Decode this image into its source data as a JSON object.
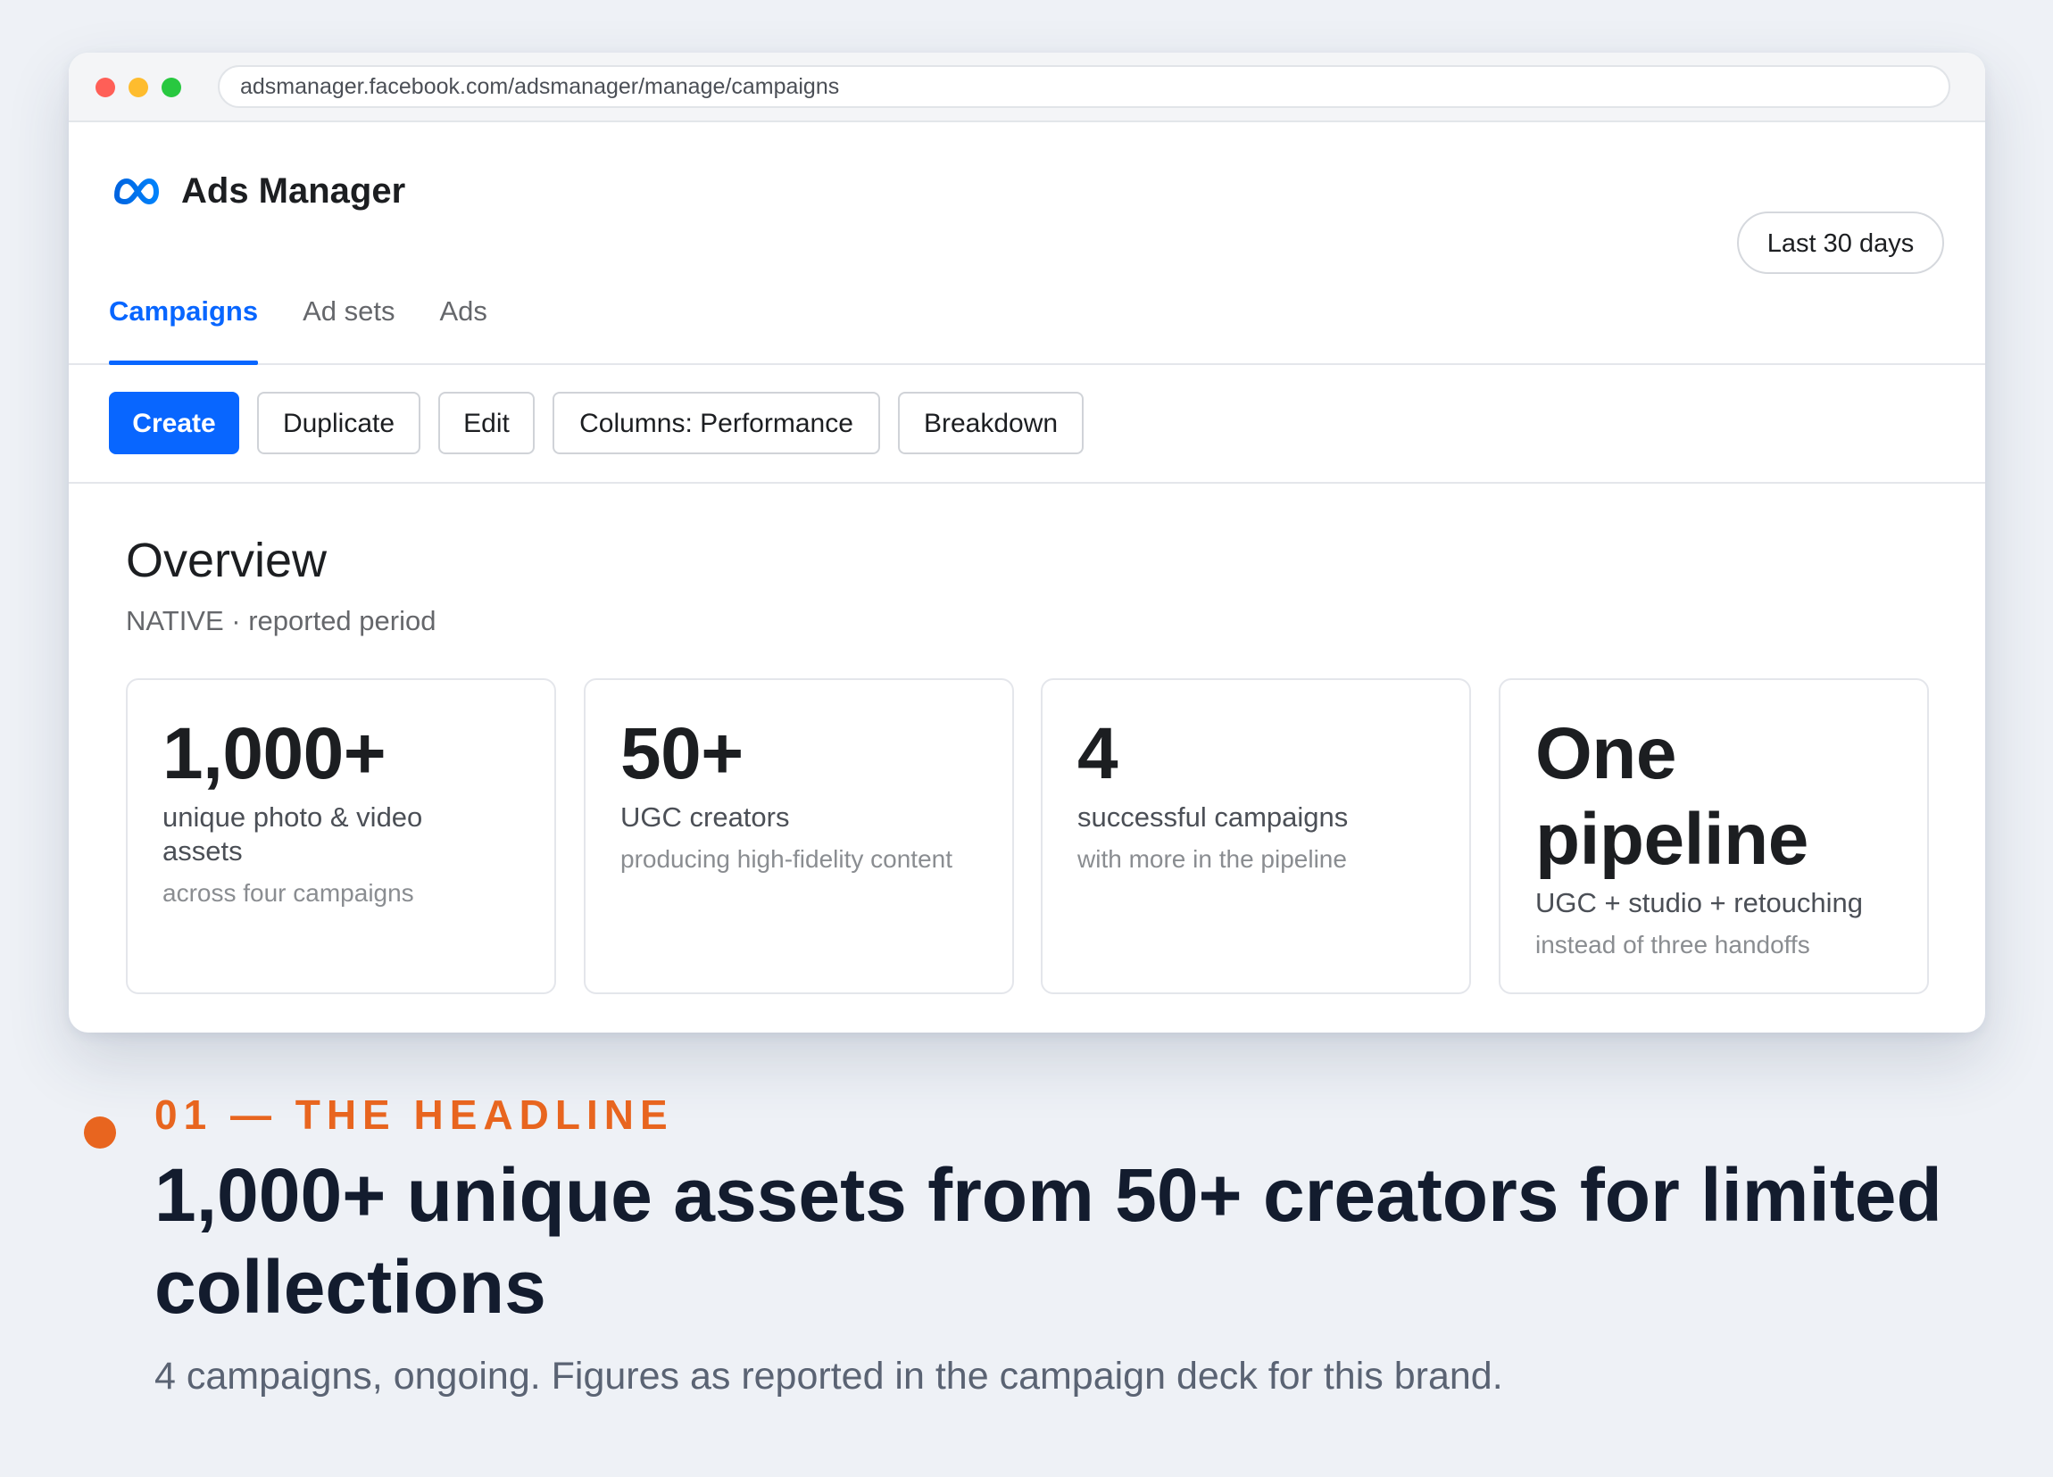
{
  "browser": {
    "url": "adsmanager.facebook.com/adsmanager/manage/campaigns"
  },
  "app": {
    "logo_icon": "meta-logo-icon",
    "title": "Ads Manager",
    "date_range": "Last 30 days",
    "accent_color": "#0866ff"
  },
  "tabs": [
    {
      "label": "Campaigns",
      "active": true
    },
    {
      "label": "Ad sets",
      "active": false
    },
    {
      "label": "Ads",
      "active": false
    }
  ],
  "toolbar": {
    "create": "Create",
    "duplicate": "Duplicate",
    "edit": "Edit",
    "columns": "Columns: Performance",
    "breakdown": "Breakdown"
  },
  "overview": {
    "title": "Overview",
    "subtitle": "NATIVE · reported period",
    "cards": [
      {
        "value": "1,000+",
        "label": "unique photo & video assets",
        "note": "across four campaigns"
      },
      {
        "value": "50+",
        "label": "UGC creators",
        "note": "producing high-fidelity content"
      },
      {
        "value": "4",
        "label": "successful campaigns",
        "note": "with more in the pipeline"
      },
      {
        "value": "One pipeline",
        "label": "UGC + studio + retouching",
        "note": "instead of three handoffs"
      }
    ]
  },
  "headline_section": {
    "eyebrow": "01 — THE HEADLINE",
    "headline": "1,000+ unique assets from 50+ creators for limited collections",
    "caption": "4 campaigns, ongoing. Figures as reported in the campaign deck for this brand.",
    "accent_color": "#e8651f"
  }
}
